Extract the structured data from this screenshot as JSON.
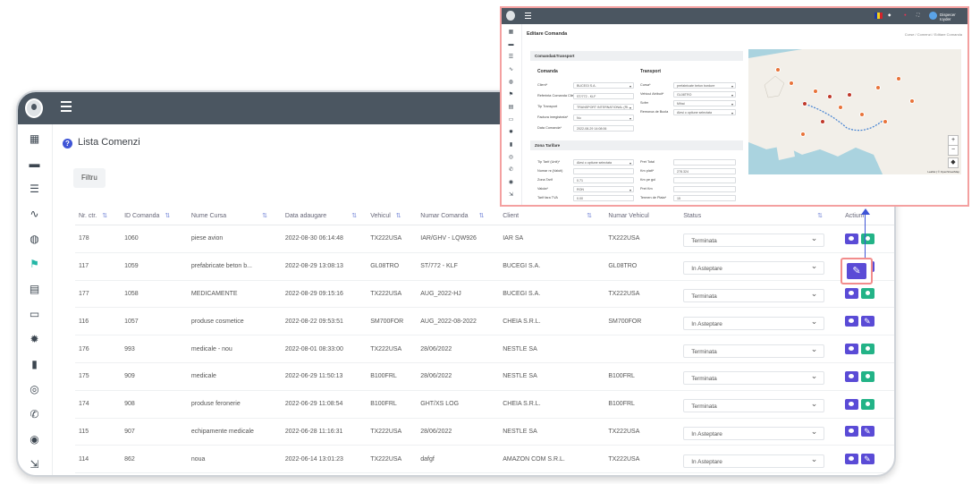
{
  "main": {
    "page_title": "Lista Comenzi",
    "filter_label": "Filtru",
    "columns": [
      "Nr. ctr.",
      "ID Comanda",
      "Nume Cursa",
      "Data adaugare",
      "Vehicul",
      "Numar Comanda",
      "Client",
      "Numar Vehicul",
      "Status",
      "Actiuni"
    ],
    "rows": [
      {
        "nr": "178",
        "id": "1060",
        "cursa": "piese avion",
        "data": "2022-08-30 06:14:48",
        "vehicul": "TX222USA",
        "numar": "IAR/GHV - LQW926",
        "client": "IAR SA",
        "nrveh": "TX222USA",
        "status": "Terminata",
        "status_kind": "done"
      },
      {
        "nr": "117",
        "id": "1059",
        "cursa": "prefabricate beton b...",
        "data": "2022-08-29 13:08:13",
        "vehicul": "GL08TRO",
        "numar": "ST/772 - KLF",
        "client": "BUCEGI S.A.",
        "nrveh": "GL08TRO",
        "status": "In Asteptare",
        "status_kind": "wait"
      },
      {
        "nr": "177",
        "id": "1058",
        "cursa": "MEDICAMENTE",
        "data": "2022-08-29 09:15:16",
        "vehicul": "TX222USA",
        "numar": "AUG_2022-HJ",
        "client": "BUCEGI S.A.",
        "nrveh": "TX222USA",
        "status": "Terminata",
        "status_kind": "done"
      },
      {
        "nr": "116",
        "id": "1057",
        "cursa": "produse cosmetice",
        "data": "2022-08-22 09:53:51",
        "vehicul": "SM700FOR",
        "numar": "AUG_2022-08-2022",
        "client": "CHEIA S.R.L.",
        "nrveh": "SM700FOR",
        "status": "In Asteptare",
        "status_kind": "wait"
      },
      {
        "nr": "176",
        "id": "993",
        "cursa": "medicale - nou",
        "data": "2022-08-01 08:33:00",
        "vehicul": "TX222USA",
        "numar": "28/06/2022",
        "client": "NESTLE SA",
        "nrveh": "",
        "status": "Terminata",
        "status_kind": "done"
      },
      {
        "nr": "175",
        "id": "909",
        "cursa": "medicale",
        "data": "2022-06-29 11:50:13",
        "vehicul": "B100FRL",
        "numar": "28/06/2022",
        "client": "NESTLE SA",
        "nrveh": "B100FRL",
        "status": "Terminata",
        "status_kind": "done"
      },
      {
        "nr": "174",
        "id": "908",
        "cursa": "produse feronerie",
        "data": "2022-06-29 11:08:54",
        "vehicul": "B100FRL",
        "numar": "GHT/XS LOG",
        "client": "CHEIA S.R.L.",
        "nrveh": "B100FRL",
        "status": "Terminata",
        "status_kind": "done"
      },
      {
        "nr": "115",
        "id": "907",
        "cursa": "echipamente medicale",
        "data": "2022-06-28 11:16:31",
        "vehicul": "TX222USA",
        "numar": "28/06/2022",
        "client": "NESTLE SA",
        "nrveh": "TX222USA",
        "status": "In Asteptare",
        "status_kind": "wait"
      },
      {
        "nr": "114",
        "id": "862",
        "cursa": "noua",
        "data": "2022-06-14 13:01:23",
        "vehicul": "TX222USA",
        "numar": "dafgf",
        "client": "AMAZON COM S.R.L.",
        "nrveh": "TX222USA",
        "status": "In Asteptare",
        "status_kind": "wait"
      }
    ]
  },
  "popup": {
    "title": "Editare Comanda",
    "breadcrumb": "Curse / Comenzi / Editare Comanda",
    "user": "Dispecer Ioyder",
    "section1": "Comanda&Transport",
    "comanda_header": "Comanda",
    "transport_header": "Transport",
    "comanda_fields": [
      {
        "label": "Client*",
        "value": "BUCEGI S.A.",
        "dd": true
      },
      {
        "label": "Referinta Comanda Client*",
        "value": "ST/772 - KLF",
        "dd": false
      },
      {
        "label": "Tip Transport",
        "value": "TRANSPORT INTERNATIONAL (RI...",
        "dd": true
      },
      {
        "label": "Factura inregistrata*",
        "value": "Nu",
        "dd": true
      },
      {
        "label": "Data Comanda*",
        "value": "2022-08-29 14:08:06",
        "dd": false
      }
    ],
    "transport_fields": [
      {
        "label": "Cursa*",
        "value": "prefabricate beton bordure",
        "dd": true
      },
      {
        "label": "Vehicul Atribuit*",
        "value": "GL08TRO",
        "dd": true
      },
      {
        "label": "Sofer",
        "value": "Mihai",
        "dd": true
      },
      {
        "label": "Remorca de Bucla",
        "value": "Alesi o optiune selectata",
        "dd": true
      }
    ],
    "section2": "Zona Tarifare",
    "tarif_left": [
      {
        "label": "Tip Tarif (Unit)*",
        "value": "Alesi o optiune selectata",
        "dd": true
      },
      {
        "label": "Numar nr.(Valuti)",
        "value": "",
        "dd": false
      },
      {
        "label": "Zona Tarif",
        "value": "0.71",
        "dd": false
      },
      {
        "label": "Valuta*",
        "value": "RON",
        "dd": true
      },
      {
        "label": "Tarif fara TVA",
        "value": "0.00",
        "dd": false
      }
    ],
    "tarif_right": [
      {
        "label": "Pret Total",
        "value": "",
        "dd": false
      },
      {
        "label": "Km plati*",
        "value": "278.324",
        "dd": false
      },
      {
        "label": "Km pe gol",
        "value": "",
        "dd": false
      },
      {
        "label": "Pret Km",
        "value": "",
        "dd": false
      },
      {
        "label": "Termen de Plata*",
        "value": "15",
        "dd": false
      }
    ],
    "map_attribution": "Leaflet | © OpenStreetMap"
  },
  "colors": {
    "topbar": "#4b5661",
    "accent": "#5a4bd6",
    "green": "#23b387",
    "teal": "#23b7a6",
    "highlight": "#f28c8c"
  }
}
